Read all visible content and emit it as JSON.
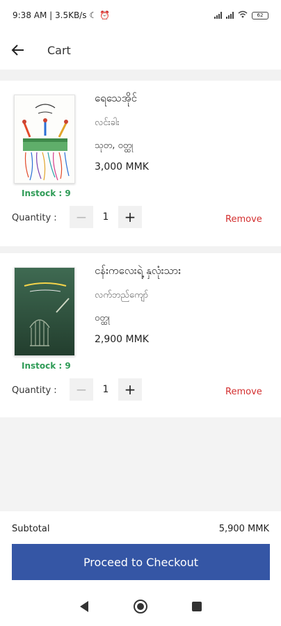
{
  "status_bar": {
    "time": "9:38 AM | 3.5KB/s",
    "battery": "62"
  },
  "app_bar": {
    "title": "Cart"
  },
  "cart": {
    "items": [
      {
        "title": "ရေသေအိုင်",
        "author": "လင်းခါး",
        "publisher": "သုတ, ဝတ္ထု",
        "price": "3,000 MMK",
        "instock_label": "Instock : 9",
        "quantity_label": "Quantity :",
        "quantity": "1",
        "remove_label": "Remove"
      },
      {
        "title": "ငန်းကလေးရဲ့ နှလုံးသား",
        "author": "လက်ဘည်ကျော်",
        "publisher": "ဝတ္ထု",
        "price": "2,900 MMK",
        "instock_label": "Instock : 9",
        "quantity_label": "Quantity :",
        "quantity": "1",
        "remove_label": "Remove"
      }
    ]
  },
  "summary": {
    "subtotal_label": "Subtotal",
    "subtotal_value": "5,900 MMK",
    "checkout_label": "Proceed to Checkout"
  },
  "colors": {
    "accent": "#3556a5",
    "instock": "#2e9b56",
    "remove": "#d32f2f"
  }
}
